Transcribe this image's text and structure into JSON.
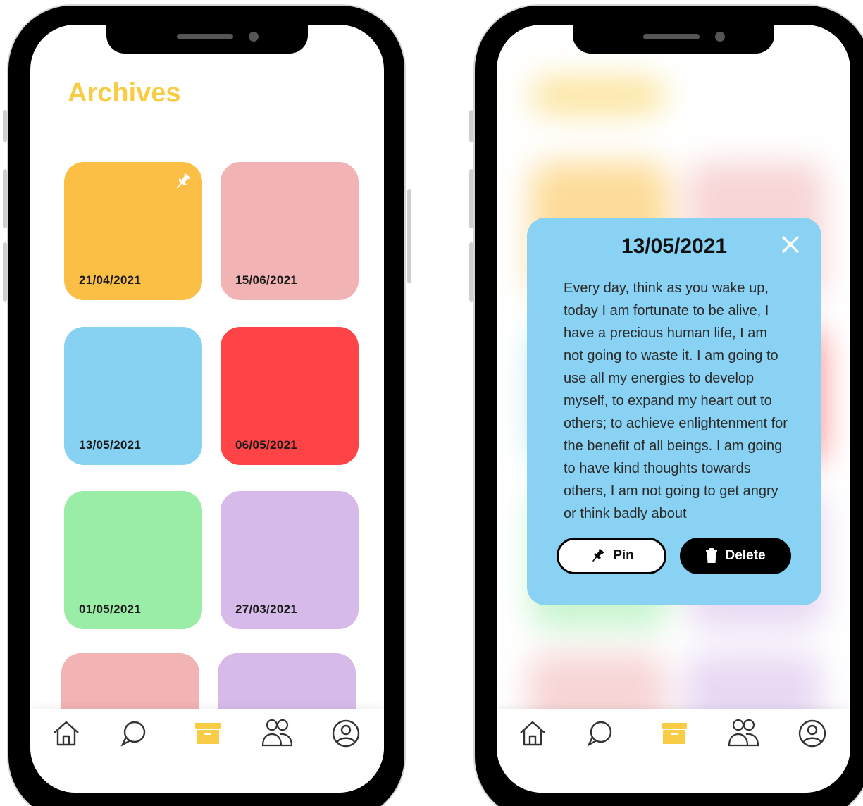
{
  "left_screen": {
    "title": "Archives",
    "cards": [
      {
        "date": "21/04/2021",
        "color": "#fbbf46",
        "pinned": true
      },
      {
        "date": "15/06/2021",
        "color": "#f1b3b4",
        "pinned": false
      },
      {
        "date": "13/05/2021",
        "color": "#87d1f2",
        "pinned": false
      },
      {
        "date": "06/05/2021",
        "color": "#fe4446",
        "pinned": false
      },
      {
        "date": "01/05/2021",
        "color": "#9aeda7",
        "pinned": false
      },
      {
        "date": "27/03/2021",
        "color": "#d6bbea",
        "pinned": false
      },
      {
        "date": "",
        "color": "#f1b3b4",
        "pinned": false
      },
      {
        "date": "",
        "color": "#d6bbea",
        "pinned": false
      }
    ]
  },
  "right_screen": {
    "modal": {
      "date": "13/05/2021",
      "text": "Every day, think as you wake up, today I am fortunate to be alive, I have a precious human life, I am not going to waste it. I am going to use all my energies to develop myself, to expand my heart out to others; to achieve enlightenment for the benefit of all beings. I am going to have kind thoughts towards others, I am not going to get angry or think badly about",
      "pin_label": "Pin",
      "delete_label": "Delete",
      "background": "#89d2f3"
    }
  },
  "nav": {
    "items": [
      {
        "icon": "home-icon",
        "active": false
      },
      {
        "icon": "chat-icon",
        "active": false
      },
      {
        "icon": "archive-icon",
        "active": true
      },
      {
        "icon": "friends-icon",
        "active": false
      },
      {
        "icon": "profile-icon",
        "active": false
      }
    ],
    "accent": "#f8cd45",
    "icon_color": "#333333"
  }
}
